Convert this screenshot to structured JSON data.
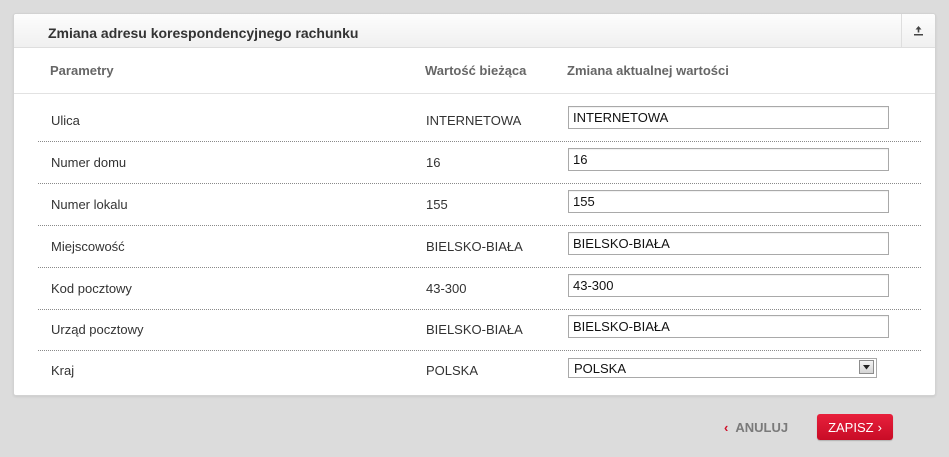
{
  "panel": {
    "title": "Zmiana adresu korespondencyjnego rachunku",
    "collapse_icon": "collapse-up-icon"
  },
  "columns": {
    "param": "Parametry",
    "current": "Wartość bieżąca",
    "change": "Zmiana aktualnej wartości"
  },
  "rows": [
    {
      "label": "Ulica",
      "current": "INTERNETOWA",
      "input": "INTERNETOWA"
    },
    {
      "label": "Numer domu",
      "current": "16",
      "input": "16"
    },
    {
      "label": "Numer lokalu",
      "current": "155",
      "input": "155"
    },
    {
      "label": "Miejscowość",
      "current": "BIELSKO-BIAŁA",
      "input": "BIELSKO-BIAŁA"
    },
    {
      "label": "Kod pocztowy",
      "current": "43-300",
      "input": "43-300"
    },
    {
      "label": "Urząd pocztowy",
      "current": "BIELSKO-BIAŁA",
      "input": "BIELSKO-BIAŁA"
    },
    {
      "label": "Kraj",
      "current": "POLSKA",
      "select": "POLSKA"
    }
  ],
  "actions": {
    "cancel": "ANULUJ",
    "save": "ZAPISZ"
  },
  "colors": {
    "accent": "#d0102a",
    "background": "#dcdcdc"
  }
}
